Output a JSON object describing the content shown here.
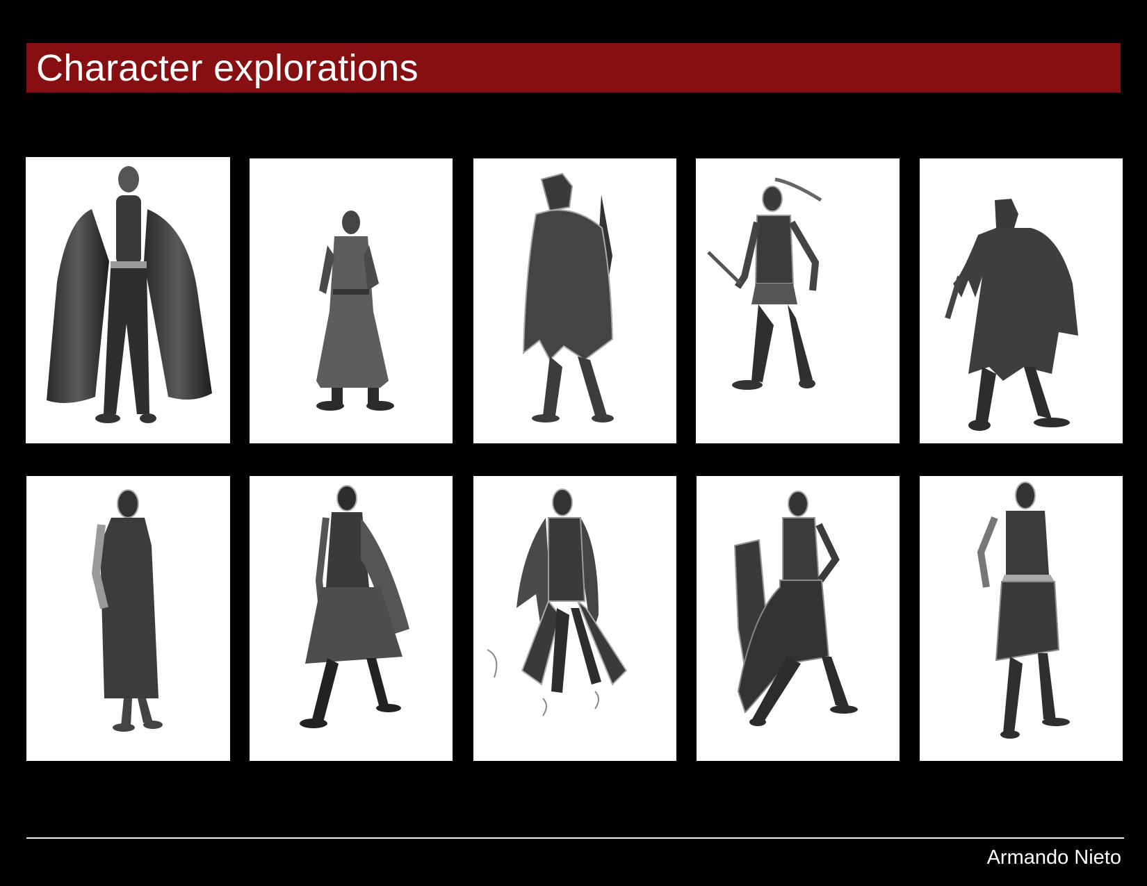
{
  "header": {
    "title": "Character explorations"
  },
  "footer": {
    "author": "Armando Nieto"
  },
  "cards": [
    {
      "row": 1,
      "col": 1,
      "figure": "caped-man-sketch"
    },
    {
      "row": 1,
      "col": 2,
      "figure": "long-coat-man-sketch"
    },
    {
      "row": 1,
      "col": 3,
      "figure": "hooded-cloak-figure-sketch"
    },
    {
      "row": 1,
      "col": 4,
      "figure": "ponytail-swordsman-sketch"
    },
    {
      "row": 1,
      "col": 5,
      "figure": "ragged-cloak-figure-sketch"
    },
    {
      "row": 2,
      "col": 1,
      "figure": "robed-masked-figure-sketch"
    },
    {
      "row": 2,
      "col": 2,
      "figure": "draped-warrior-sketch"
    },
    {
      "row": 2,
      "col": 3,
      "figure": "bladed-coat-figure-sketch"
    },
    {
      "row": 2,
      "col": 4,
      "figure": "shield-bearer-sketch"
    },
    {
      "row": 2,
      "col": 5,
      "figure": "skirted-masked-figure-sketch"
    }
  ]
}
